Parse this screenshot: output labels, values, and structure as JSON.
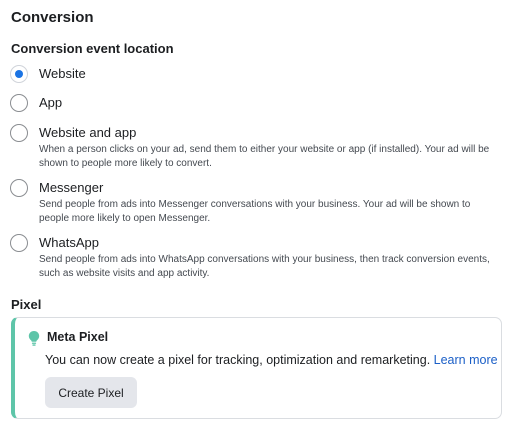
{
  "section": {
    "title": "Conversion"
  },
  "conversion_location": {
    "label": "Conversion event location",
    "selected": "Website",
    "options": [
      {
        "label": "Website",
        "description": "",
        "checked": true
      },
      {
        "label": "App",
        "description": "",
        "checked": false
      },
      {
        "label": "Website and app",
        "description": "When a person clicks on your ad, send them to either your website or app (if installed). Your ad will be shown to people more likely to convert.",
        "checked": false
      },
      {
        "label": "Messenger",
        "description": "Send people from ads into Messenger conversations with your business. Your ad will be shown to people more likely to open Messenger.",
        "checked": false
      },
      {
        "label": "WhatsApp",
        "description": "Send people from ads into WhatsApp conversations with your business, then track conversion events, such as website visits and app activity.",
        "checked": false
      }
    ]
  },
  "pixel": {
    "label": "Pixel",
    "card": {
      "icon": "lightbulb-icon",
      "title": "Meta Pixel",
      "text": "You can now create a pixel for tracking, optimization and remarketing.",
      "link_label": "Learn more",
      "button_label": "Create Pixel",
      "accent_color": "#5ec5a9"
    }
  },
  "colors": {
    "radio_selected": "#1b74e4",
    "link": "#1b5fc7",
    "button_bg": "#e4e6eb"
  }
}
